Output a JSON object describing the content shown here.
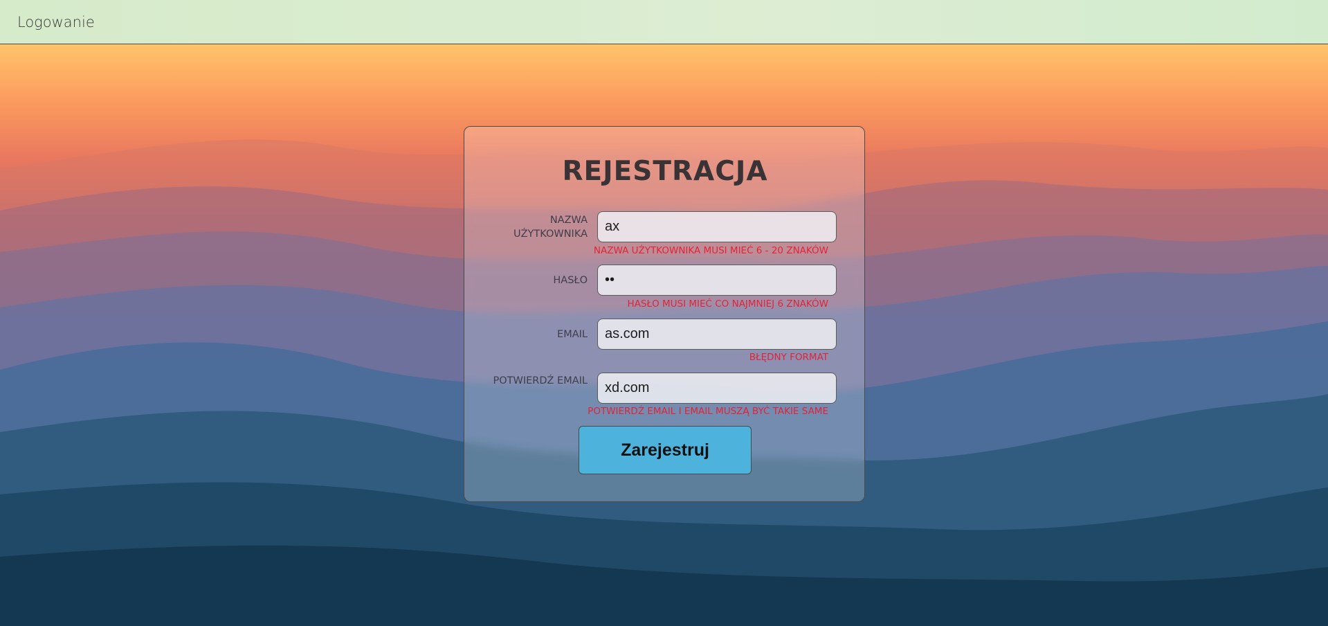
{
  "nav": {
    "login_link": "Logowanie"
  },
  "form": {
    "title": "REJESTRACJA",
    "fields": [
      {
        "label": "NAZWA UŻYTKOWNIKA",
        "value": "ax",
        "type": "text",
        "error": "NAZWA UŻYTKOWNIKA MUSI MIEĆ 6 - 20 ZNAKÓW"
      },
      {
        "label": "HASŁO",
        "value": "ab",
        "type": "password",
        "error": "HASŁO MUSI MIEĆ CO NAJMNIEJ 6 ZNAKÓW"
      },
      {
        "label": "EMAIL",
        "value": "as.com",
        "type": "text",
        "error": "BŁĘDNY FORMAT"
      },
      {
        "label": "POTWIERDŹ EMAIL",
        "value": "xd.com",
        "type": "text",
        "error": "POTWIERDŹ EMAIL I EMAIL MUSZĄ BYĆ TAKIE SAME"
      }
    ],
    "submit_label": "Zarejestruj"
  },
  "colors": {
    "error": "#e0243a",
    "button": "#4db3dd",
    "navbar": "#d6ebca"
  }
}
